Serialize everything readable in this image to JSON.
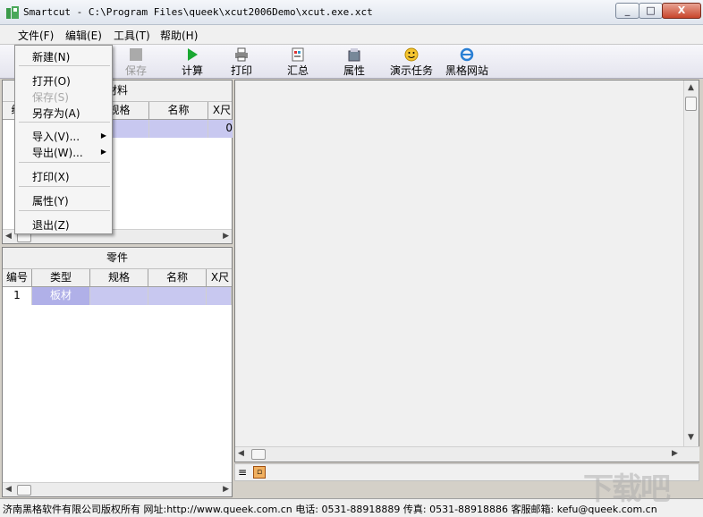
{
  "window": {
    "title": "Smartcut - C:\\Program Files\\queek\\xcut2006Demo\\xcut.exe.xct",
    "minimize": "_",
    "maximize": "□",
    "close": "X"
  },
  "menubar": [
    {
      "label": "文件(F)"
    },
    {
      "label": "编辑(E)"
    },
    {
      "label": "工具(T)"
    },
    {
      "label": "帮助(H)"
    }
  ],
  "toolbar": {
    "save": "保存",
    "calculate": "计算",
    "print": "打印",
    "summary": "汇总",
    "properties": "属性",
    "demo": "演示任务",
    "website": "黑格网站"
  },
  "file_menu": {
    "new": "新建(N)",
    "open": "打开(O)",
    "save": "保存(S)",
    "save_as": "另存为(A)",
    "import": "导入(V)...",
    "export": "导出(W)...",
    "print": "打印(X)",
    "properties": "属性(Y)",
    "exit": "退出(Z)"
  },
  "materials": {
    "title": "材料",
    "columns": [
      "编",
      "规格",
      "名称",
      "X尺"
    ],
    "rows": [
      [
        "",
        "",
        "",
        "0"
      ]
    ]
  },
  "parts": {
    "title": "零件",
    "columns": [
      "编号",
      "类型",
      "规格",
      "名称",
      "X尺"
    ],
    "rows": [
      [
        "1",
        "板材",
        "",
        "",
        ""
      ]
    ]
  },
  "statusbar": {
    "text": "济南黑格软件有限公司版权所有 网址:http://www.queek.com.cn 电话: 0531-88918889 传真: 0531-88918886 客服邮箱: kefu@queek.com.cn"
  },
  "watermark": "下载吧",
  "colors": {
    "selection": "#c8c8f0",
    "menu_bg": "#f5f5f5",
    "toolbar_green": "#1aa832"
  }
}
